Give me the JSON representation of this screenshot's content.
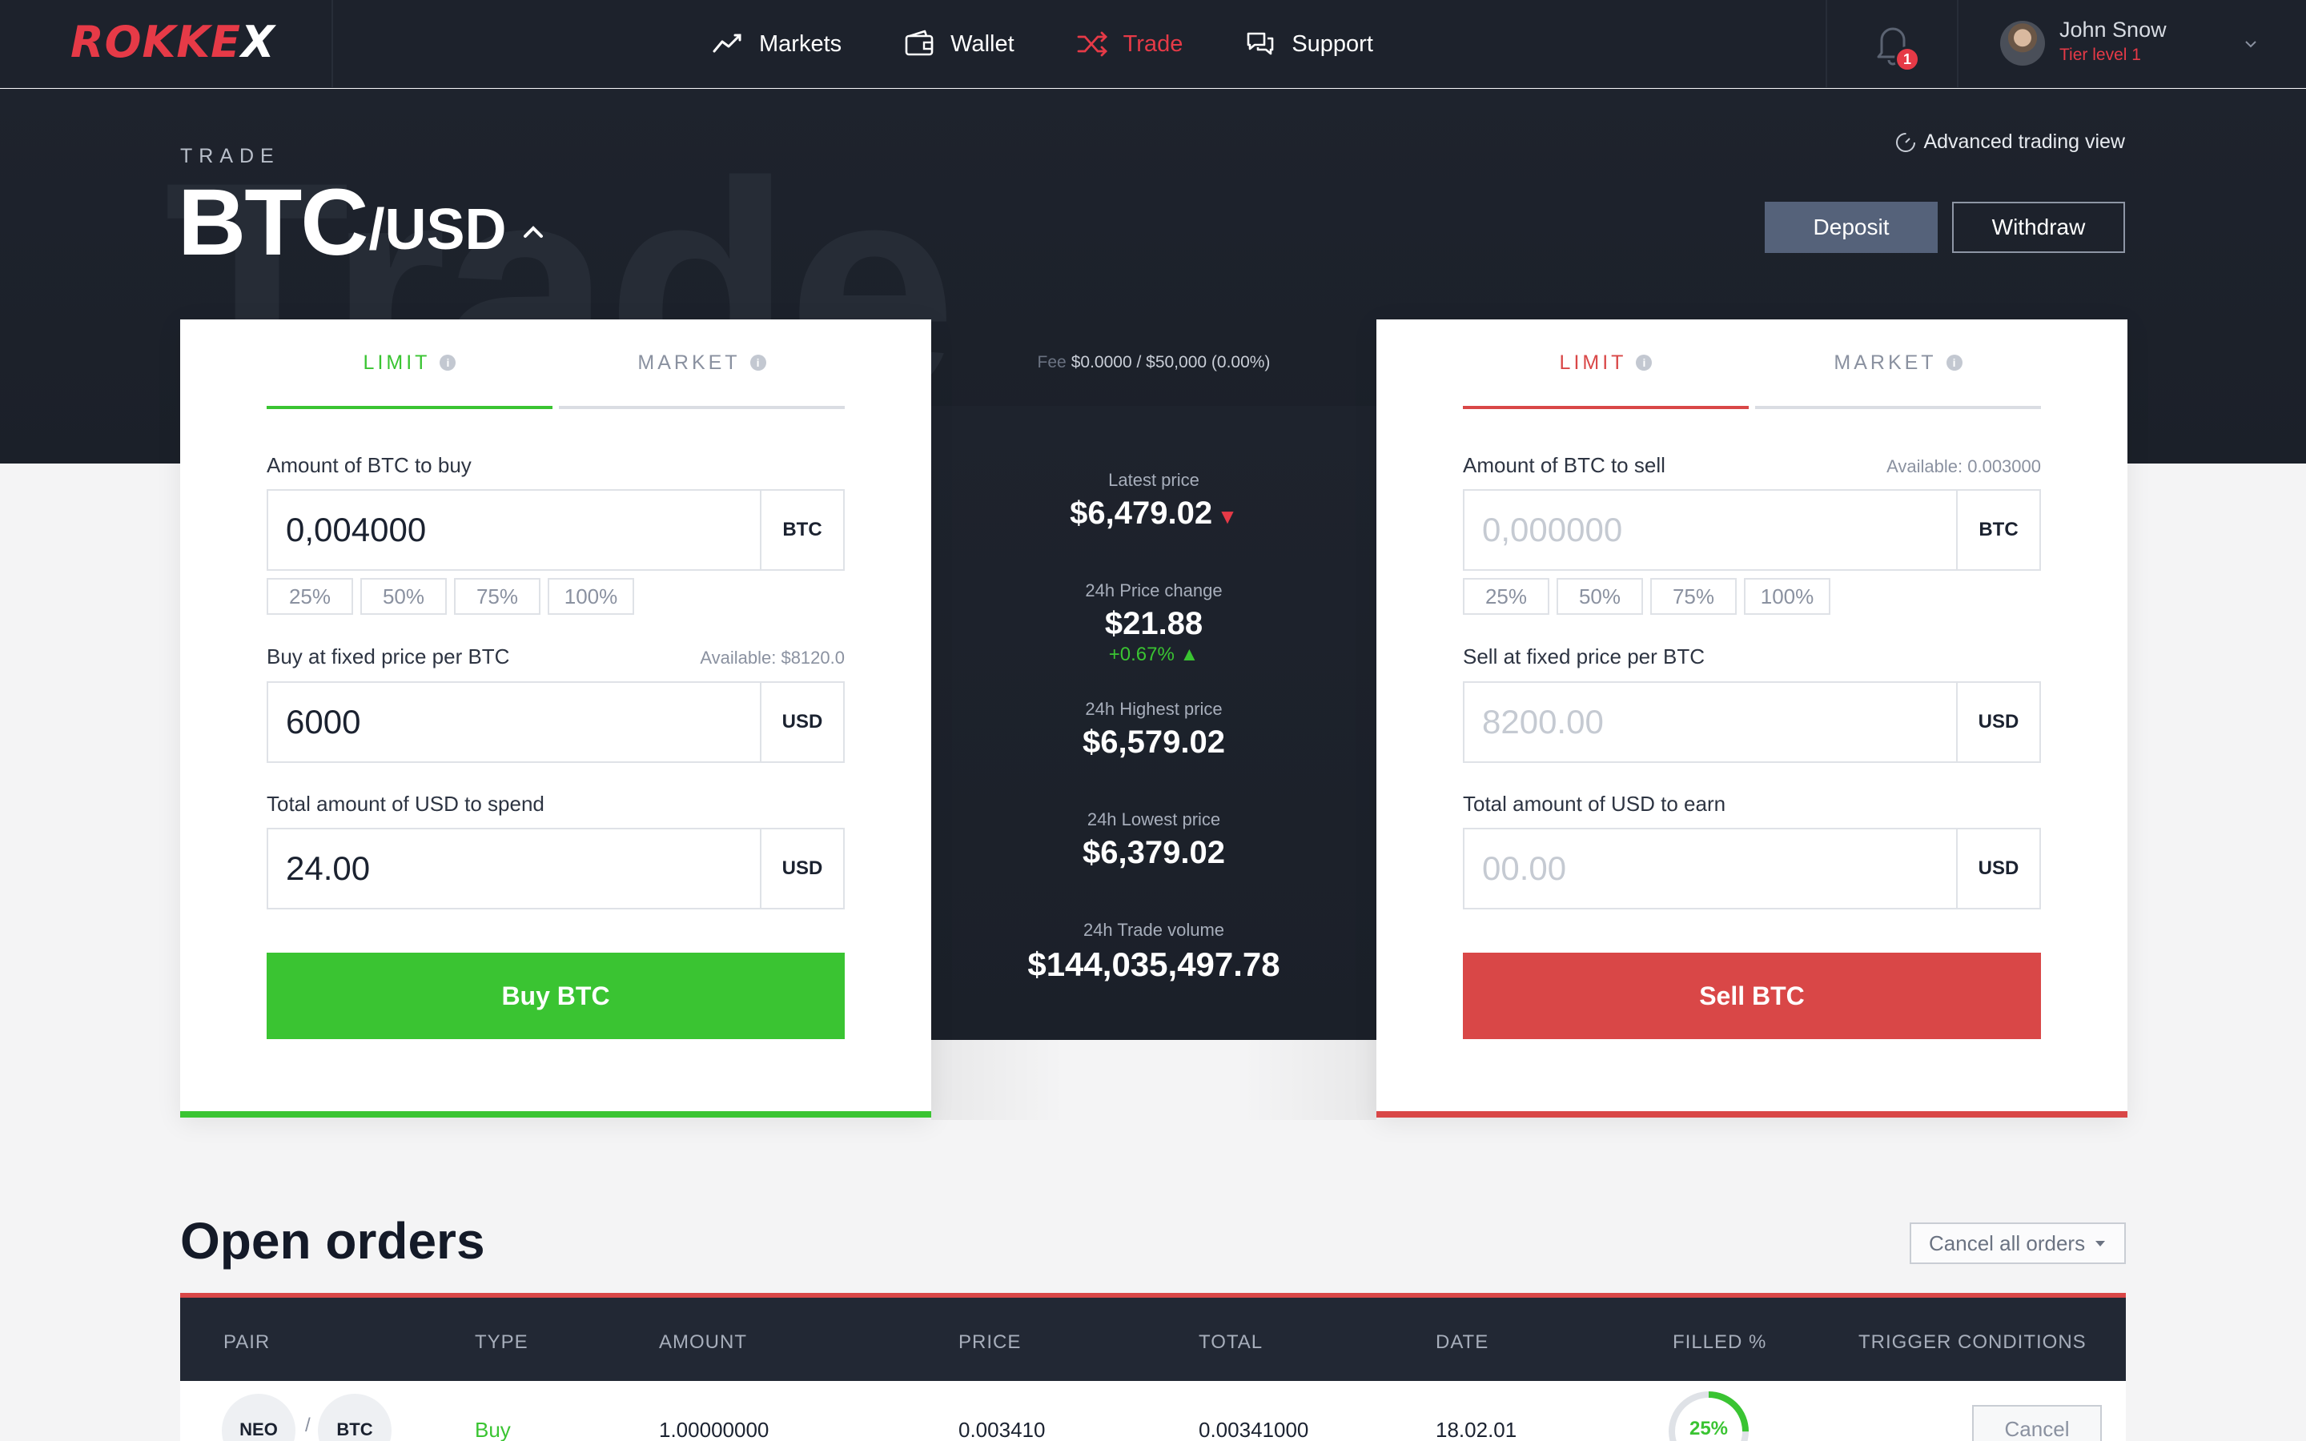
{
  "brand": {
    "logo_text": "ROKKE",
    "logo_x": "X"
  },
  "nav": {
    "items": [
      {
        "label": "Markets",
        "icon": "chart-line-icon"
      },
      {
        "label": "Wallet",
        "icon": "wallet-icon"
      },
      {
        "label": "Trade",
        "icon": "shuffle-icon",
        "active": true
      },
      {
        "label": "Support",
        "icon": "chat-bubbles-icon"
      }
    ],
    "notifications_count": "1"
  },
  "user": {
    "name": "John Snow",
    "tier": "Tier level 1"
  },
  "hero": {
    "section_label": "TRADE",
    "watermark": "Trade",
    "pair_base": "BTC",
    "pair_quote": "/USD",
    "advanced_link": "Advanced trading view",
    "deposit_label": "Deposit",
    "withdraw_label": "Withdraw"
  },
  "buy": {
    "tabs": [
      "LIMIT",
      "MARKET"
    ],
    "amount_label": "Amount of BTC to buy",
    "amount_value": "0,004000",
    "amount_unit": "BTC",
    "percents": [
      "25%",
      "50%",
      "75%",
      "100%"
    ],
    "price_label": "Buy at fixed price per BTC",
    "available": "Available: $8120.0",
    "price_value": "6000",
    "price_unit": "USD",
    "total_label": "Total amount of USD to spend",
    "total_value": "24.00",
    "total_unit": "USD",
    "action_label": "Buy BTC"
  },
  "sell": {
    "tabs": [
      "LIMIT",
      "MARKET"
    ],
    "amount_label": "Amount of BTC to sell",
    "available": "Available: 0.003000",
    "amount_placeholder": "0,000000",
    "amount_unit": "BTC",
    "percents": [
      "25%",
      "50%",
      "75%",
      "100%"
    ],
    "price_label": "Sell at fixed price per BTC",
    "price_placeholder": "8200.00",
    "price_unit": "USD",
    "total_label": "Total amount of USD to earn",
    "total_placeholder": "00.00",
    "total_unit": "USD",
    "action_label": "Sell BTC"
  },
  "stats": {
    "fee_label": "Fee",
    "fee_value": "$0.0000 / $50,000 (0.00%)",
    "latest_label": "Latest price",
    "latest_value": "$6,479.02",
    "change_label": "24h Price change",
    "change_value": "$21.88",
    "change_pct": "+0.67% ▲",
    "high_label": "24h Highest price",
    "high_value": "$6,579.02",
    "low_label": "24h Lowest price",
    "low_value": "$6,379.02",
    "volume_label": "24h Trade volume",
    "volume_value": "$144,035,497.78"
  },
  "orders": {
    "title": "Open orders",
    "cancel_all_label": "Cancel all orders",
    "columns": [
      "PAIR",
      "TYPE",
      "AMOUNT",
      "PRICE",
      "TOTAL",
      "DATE",
      "FILLED %",
      "TRIGGER CONDITIONS"
    ],
    "rows": [
      {
        "base": "NEO",
        "separator": "/",
        "quote": "BTC",
        "type": "Buy",
        "amount": "1.00000000",
        "price": "0.003410",
        "total": "0.00341000",
        "date": "18.02.01",
        "filled": "25%",
        "filled_fraction": 0.25,
        "cancel_label": "Cancel"
      }
    ]
  },
  "colors": {
    "brand_red": "#e63a47",
    "buy_green": "#3ac432",
    "sell_red": "#d94747",
    "dark_bg": "#1d222c"
  }
}
